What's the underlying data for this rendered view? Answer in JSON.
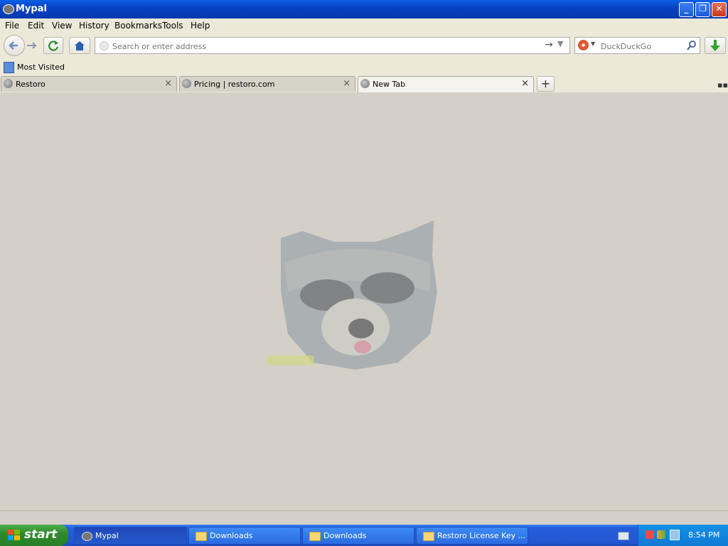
{
  "window": {
    "title": "Mypal"
  },
  "menu": [
    "File",
    "Edit",
    "View",
    "History",
    "Bookmarks",
    "Tools",
    "Help"
  ],
  "urlbar": {
    "placeholder": "Search or enter address"
  },
  "searchbar": {
    "placeholder": "DuckDuckGo"
  },
  "bookmarks": {
    "most_visited": "Most Visited"
  },
  "tabs": [
    {
      "label": "Restoro"
    },
    {
      "label": "Pricing | restoro.com"
    },
    {
      "label": "New Tab"
    }
  ],
  "taskbar": {
    "start": "start",
    "tasks": [
      {
        "label": "Mypal"
      },
      {
        "label": "Downloads"
      },
      {
        "label": "Downloads"
      },
      {
        "label": "Restoro License Key ..."
      }
    ],
    "clock": "8:54 PM"
  },
  "colors": {
    "titlebar": "#0842c4",
    "taskbar": "#245edb",
    "start": "#2e8a2c",
    "content_bg": "#d4d0c8"
  }
}
